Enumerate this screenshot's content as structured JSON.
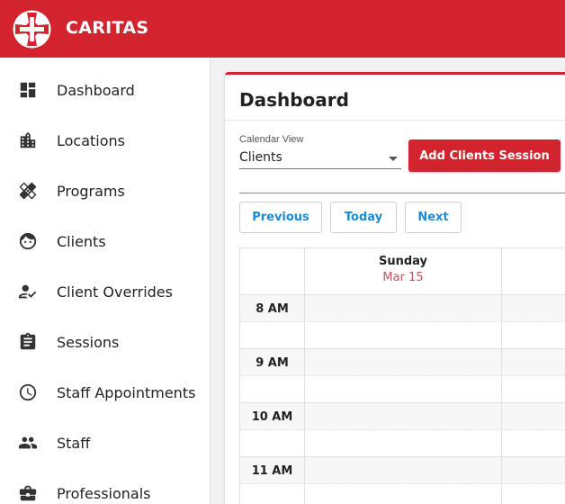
{
  "app": {
    "brand": "CARITAS",
    "accent_color": "#d2232e",
    "logo_icon": "caritas-cross-icon"
  },
  "sidebar": {
    "items": [
      {
        "label": "Dashboard",
        "icon": "dashboard-icon"
      },
      {
        "label": "Locations",
        "icon": "building-icon"
      },
      {
        "label": "Programs",
        "icon": "bandage-icon"
      },
      {
        "label": "Clients",
        "icon": "face-icon"
      },
      {
        "label": "Client Overrides",
        "icon": "person-check-icon"
      },
      {
        "label": "Sessions",
        "icon": "clipboard-icon"
      },
      {
        "label": "Staff Appointments",
        "icon": "clock-icon"
      },
      {
        "label": "Staff",
        "icon": "people-icon"
      },
      {
        "label": "Professionals",
        "icon": "briefcase-icon"
      }
    ]
  },
  "main": {
    "title": "Dashboard",
    "calendar_view": {
      "label": "Calendar View",
      "value": "Clients"
    },
    "add_button": "Add Clients Session",
    "nav": {
      "previous": "Previous",
      "today": "Today",
      "next": "Next"
    },
    "calendar": {
      "day": {
        "name": "Sunday",
        "date": "Mar 15"
      },
      "times": [
        "8 AM",
        "9 AM",
        "10 AM",
        "11 AM"
      ]
    }
  }
}
